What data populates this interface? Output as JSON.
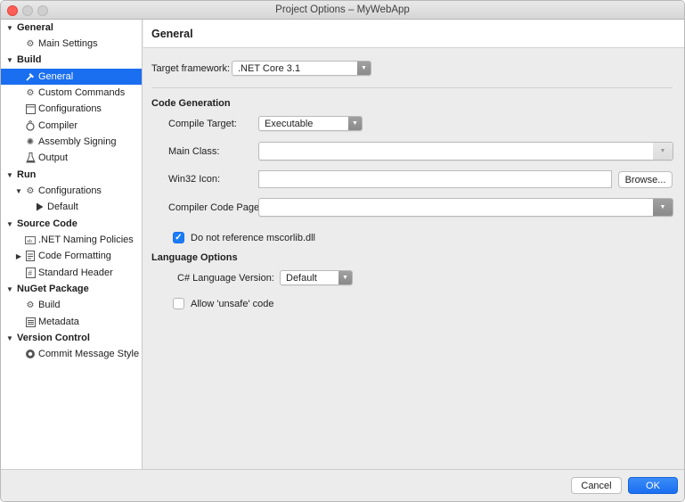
{
  "window": {
    "title": "Project Options – MyWebApp"
  },
  "sidebar": {
    "groups": [
      {
        "label": "General",
        "items": [
          {
            "label": "Main Settings",
            "icon": "gear-icon"
          }
        ]
      },
      {
        "label": "Build",
        "items": [
          {
            "label": "General",
            "icon": "hammer-icon",
            "selected": true
          },
          {
            "label": "Custom Commands",
            "icon": "gear-icon"
          },
          {
            "label": "Configurations",
            "icon": "window-icon"
          },
          {
            "label": "Compiler",
            "icon": "compiler-icon"
          },
          {
            "label": "Assembly Signing",
            "icon": "seal-icon"
          },
          {
            "label": "Output",
            "icon": "flask-icon"
          }
        ]
      },
      {
        "label": "Run",
        "items": [
          {
            "label": "Configurations",
            "icon": "gear-icon",
            "expanded": true
          },
          {
            "label": "Default",
            "icon": "play-icon"
          }
        ]
      },
      {
        "label": "Source Code",
        "items": [
          {
            "label": ".NET Naming Policies",
            "icon": "naming-icon"
          },
          {
            "label": "Code Formatting",
            "icon": "document-icon",
            "collapsed": true
          },
          {
            "label": "Standard Header",
            "icon": "hash-icon"
          }
        ]
      },
      {
        "label": "NuGet Package",
        "items": [
          {
            "label": "Build",
            "icon": "gear-icon"
          },
          {
            "label": "Metadata",
            "icon": "list-icon"
          }
        ]
      },
      {
        "label": "Version Control",
        "items": [
          {
            "label": "Commit Message Style",
            "icon": "vc-icon"
          }
        ]
      }
    ]
  },
  "main": {
    "page_title": "General",
    "target_framework": {
      "label": "Target framework:",
      "value": ".NET Core 3.1"
    },
    "code_generation": {
      "title": "Code Generation",
      "compile_target": {
        "label": "Compile Target:",
        "value": "Executable"
      },
      "main_class": {
        "label": "Main Class:",
        "value": ""
      },
      "win32_icon": {
        "label": "Win32 Icon:",
        "value": "",
        "browse_label": "Browse..."
      },
      "compiler_code_page": {
        "label": "Compiler Code Page:",
        "value": ""
      },
      "no_mscorlib": {
        "label": "Do not reference mscorlib.dll",
        "checked": true
      }
    },
    "language_options": {
      "title": "Language Options",
      "csharp_version": {
        "label": "C# Language Version:",
        "value": "Default"
      },
      "allow_unsafe": {
        "label": "Allow 'unsafe' code",
        "checked": false
      }
    }
  },
  "footer": {
    "cancel_label": "Cancel",
    "ok_label": "OK"
  },
  "colors": {
    "accent": "#1a6ef0",
    "close_button": "#ff5f57"
  }
}
